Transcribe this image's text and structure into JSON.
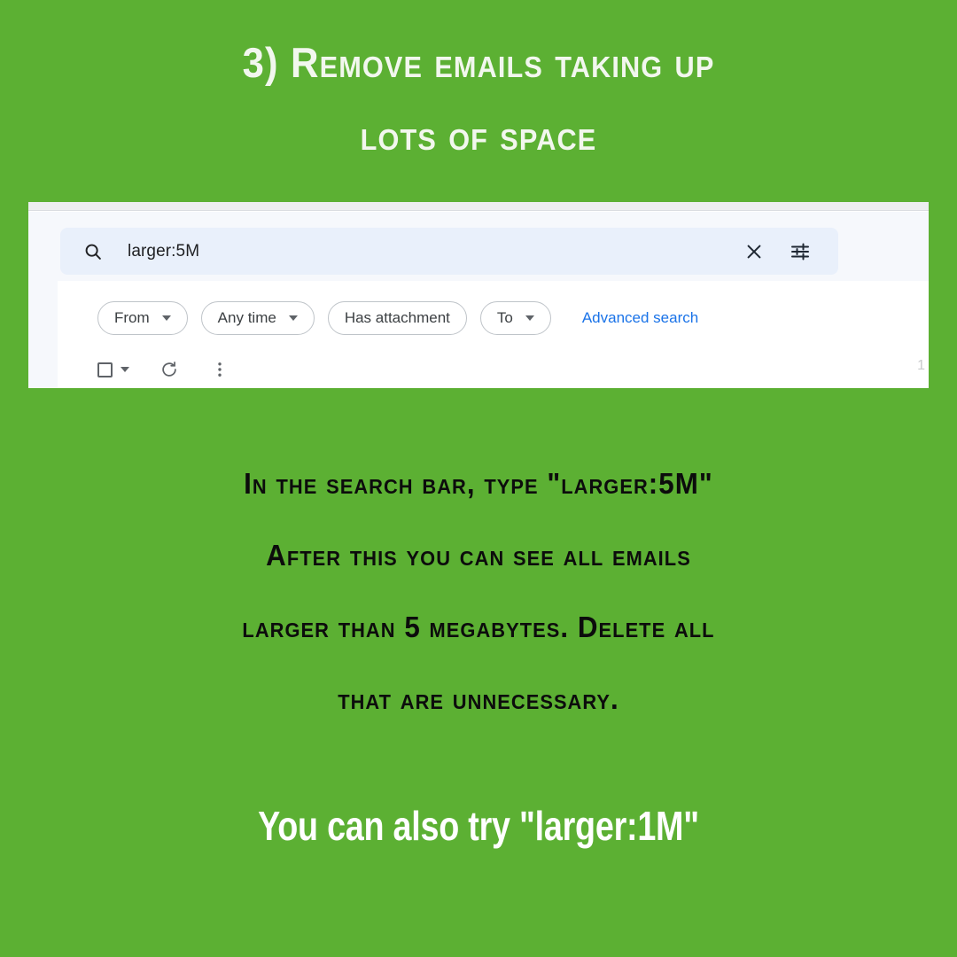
{
  "theme": {
    "background": "#5CB033",
    "heading_color": "#F2F7EE",
    "body_color": "#0C0C0C",
    "footer_color": "#FFFFFF",
    "link_color": "#1A73E8",
    "search_field_bg": "#E9F0FB"
  },
  "heading": {
    "line1": "3) Remove emails taking up",
    "line2": "lots of space"
  },
  "screenshot": {
    "top_strip_ghost": "",
    "top_strip_ghost_right": "",
    "search": {
      "icon": "search-icon",
      "value": "larger:5M",
      "clear_icon": "close-icon",
      "tune_icon": "tune-icon"
    },
    "chips": [
      {
        "label": "From",
        "has_caret": true
      },
      {
        "label": "Any time",
        "has_caret": true
      },
      {
        "label": "Has attachment",
        "has_caret": false
      },
      {
        "label": "To",
        "has_caret": true
      }
    ],
    "advanced_search": "Advanced search",
    "toolbar": {
      "select_all_icon": "checkbox-icon",
      "select_caret_icon": "chevron-down-icon",
      "refresh_icon": "refresh-icon",
      "more_icon": "more-vertical-icon"
    },
    "page_count": "1"
  },
  "body": {
    "line1": "In the search bar, type \"larger:5M\"",
    "line2": "After this you can see all emails",
    "line3": "larger than 5 megabytes. Delete all",
    "line4": "that are unnecessary."
  },
  "footer": {
    "text": "You can also try \"larger:1M\""
  }
}
